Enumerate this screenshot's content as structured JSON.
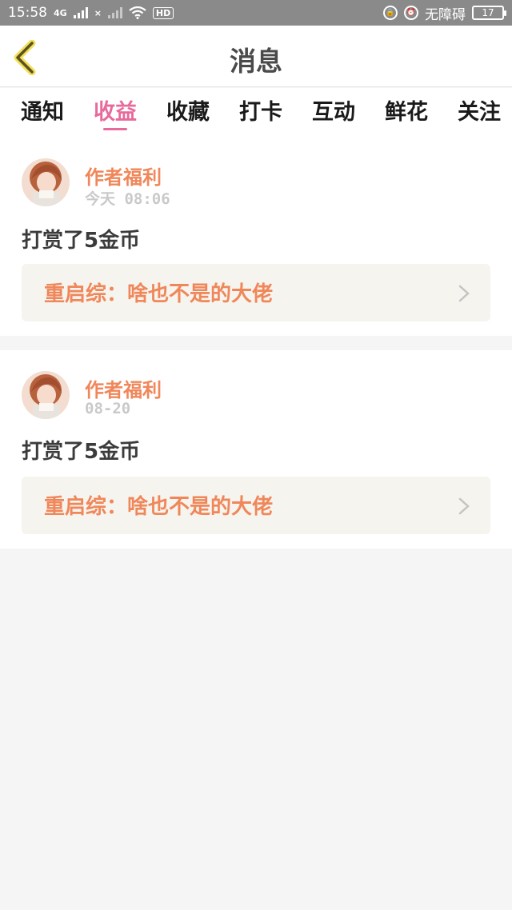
{
  "status_bar": {
    "time": "15:58",
    "network_1": "4G",
    "network_2": "×",
    "hd": "HD",
    "accessibility": "无障碍",
    "battery": "17"
  },
  "header": {
    "title": "消息"
  },
  "tabs": [
    {
      "label": "通知",
      "active": false
    },
    {
      "label": "收益",
      "active": true
    },
    {
      "label": "收藏",
      "active": false
    },
    {
      "label": "打卡",
      "active": false
    },
    {
      "label": "互动",
      "active": false
    },
    {
      "label": "鲜花",
      "active": false
    },
    {
      "label": "关注",
      "active": false
    }
  ],
  "messages": [
    {
      "sender": "作者福利",
      "time": "今天 08:06",
      "text": "打赏了5金币",
      "book": "重启综：啥也不是的大佬"
    },
    {
      "sender": "作者福利",
      "time": "08-20",
      "text": "打赏了5金币",
      "book": "重启综：啥也不是的大佬"
    }
  ],
  "colors": {
    "accent": "#e8699b",
    "orange": "#f0875a",
    "background": "#f6f5f5"
  }
}
